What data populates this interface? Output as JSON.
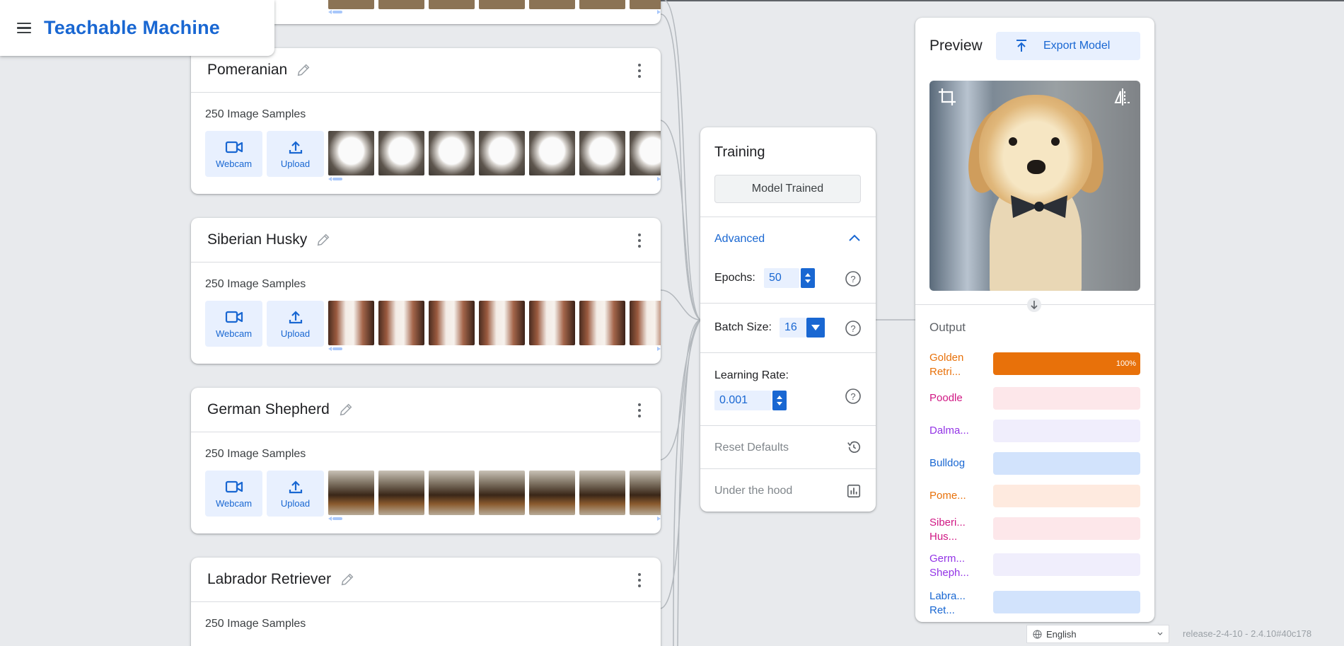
{
  "app": {
    "title": "Teachable Machine"
  },
  "classes": [
    {
      "name": "Pomeranian",
      "sample_count": "250 Image Samples",
      "webcam_label": "Webcam",
      "upload_label": "Upload"
    },
    {
      "name": "Siberian Husky",
      "sample_count": "250 Image Samples",
      "webcam_label": "Webcam",
      "upload_label": "Upload"
    },
    {
      "name": "German Shepherd",
      "sample_count": "250 Image Samples",
      "webcam_label": "Webcam",
      "upload_label": "Upload"
    },
    {
      "name": "Labrador Retriever",
      "sample_count": "250 Image Samples",
      "webcam_label": "Webcam",
      "upload_label": "Upload"
    }
  ],
  "training": {
    "title": "Training",
    "trained_button": "Model Trained",
    "advanced_label": "Advanced",
    "epochs_label": "Epochs:",
    "epochs_value": "50",
    "batch_label": "Batch Size:",
    "batch_value": "16",
    "lr_label": "Learning Rate:",
    "lr_value": "0.001",
    "reset_label": "Reset Defaults",
    "hood_label": "Under the hood"
  },
  "preview": {
    "title": "Preview",
    "export_label": "Export Model",
    "output_label": "Output",
    "outputs": [
      {
        "name": "Golden Retri...",
        "color": "#e8710a",
        "bg": "#e8710a",
        "value": 1.0,
        "pct_label": "100%"
      },
      {
        "name": "Poodle",
        "color": "#d01884",
        "bg": "#fde7ea",
        "value": 0
      },
      {
        "name": "Dalma...",
        "color": "#9334e6",
        "bg": "#f0eefc",
        "value": 0
      },
      {
        "name": "Bulldog",
        "color": "#1967d2",
        "bg": "#d2e3fc",
        "value": 0
      },
      {
        "name": "Pome...",
        "color": "#e8710a",
        "bg": "#feeadf",
        "value": 0
      },
      {
        "name": "Siberi... Hus...",
        "color": "#d01884",
        "bg": "#fde7ea",
        "value": 0
      },
      {
        "name": "Germ... Sheph...",
        "color": "#9334e6",
        "bg": "#f0eefc",
        "value": 0
      },
      {
        "name": "Labra... Ret...",
        "color": "#1967d2",
        "bg": "#d2e3fc",
        "value": 0
      }
    ]
  },
  "footer": {
    "language": "English",
    "release": "release-2-4-10 - 2.4.10#40c178"
  }
}
